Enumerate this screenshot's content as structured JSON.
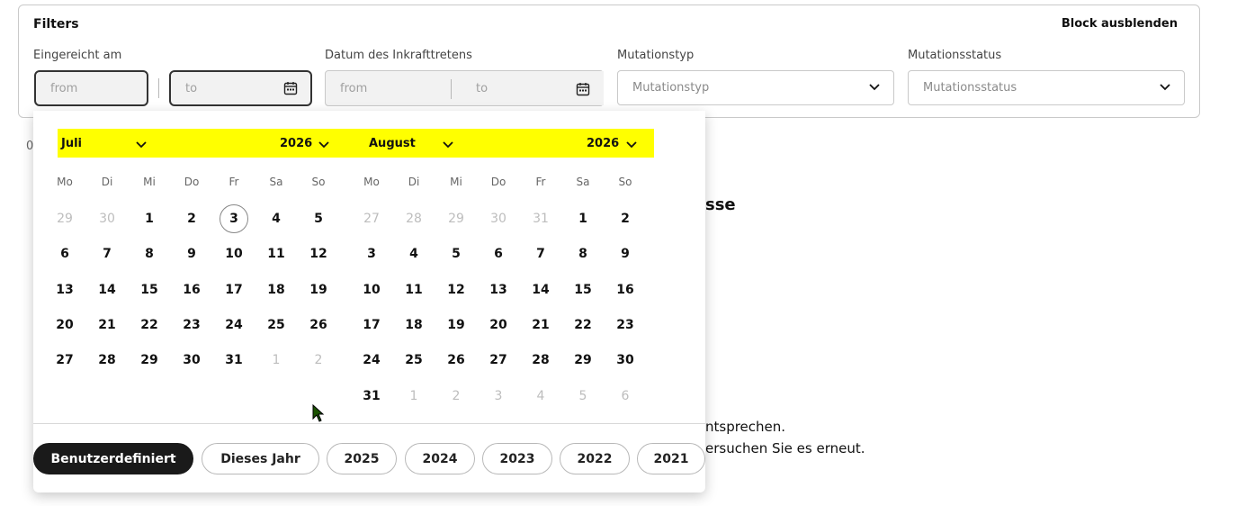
{
  "filters": {
    "title": "Filters",
    "hide_label": "Block ausblenden",
    "submitted": {
      "label": "Eingereicht am",
      "from_placeholder": "from",
      "to_placeholder": "to"
    },
    "effective": {
      "label": "Datum des Inkrafttretens",
      "from_placeholder": "from",
      "to_placeholder": "to"
    },
    "mutation_type": {
      "label": "Mutationstyp",
      "value": "Mutationstyp"
    },
    "mutation_status": {
      "label": "Mutationsstatus",
      "value": "Mutationsstatus"
    }
  },
  "background": {
    "count_fragment": "0",
    "heading_fragment": "sse",
    "line1_fragment": "ntsprechen.",
    "line2_fragment": "ersuchen Sie es erneut."
  },
  "calendar": {
    "weekdays": [
      "Mo",
      "Di",
      "Mi",
      "Do",
      "Fr",
      "Sa",
      "So"
    ],
    "left": {
      "month": "Juli",
      "year": "2026",
      "days": [
        [
          "29",
          "30",
          "1",
          "2",
          "3",
          "4",
          "5"
        ],
        [
          "6",
          "7",
          "8",
          "9",
          "10",
          "11",
          "12"
        ],
        [
          "13",
          "14",
          "15",
          "16",
          "17",
          "18",
          "19"
        ],
        [
          "20",
          "21",
          "22",
          "23",
          "24",
          "25",
          "26"
        ],
        [
          "27",
          "28",
          "29",
          "30",
          "31",
          "1",
          "2"
        ]
      ]
    },
    "right": {
      "month": "August",
      "year": "2026",
      "days": [
        [
          "27",
          "28",
          "29",
          "30",
          "31",
          "1",
          "2"
        ],
        [
          "3",
          "4",
          "5",
          "6",
          "7",
          "8",
          "9"
        ],
        [
          "10",
          "11",
          "12",
          "13",
          "14",
          "15",
          "16"
        ],
        [
          "17",
          "18",
          "19",
          "20",
          "21",
          "22",
          "23"
        ],
        [
          "24",
          "25",
          "26",
          "27",
          "28",
          "29",
          "30"
        ],
        [
          "31",
          "1",
          "2",
          "3",
          "4",
          "5",
          "6"
        ]
      ]
    },
    "today": "3",
    "highlight_color": "#ffff00"
  },
  "presets": [
    "Benutzerdefiniert",
    "Dieses Jahr",
    "2025",
    "2024",
    "2023",
    "2022",
    "2021"
  ],
  "active_preset": "Benutzerdefiniert"
}
